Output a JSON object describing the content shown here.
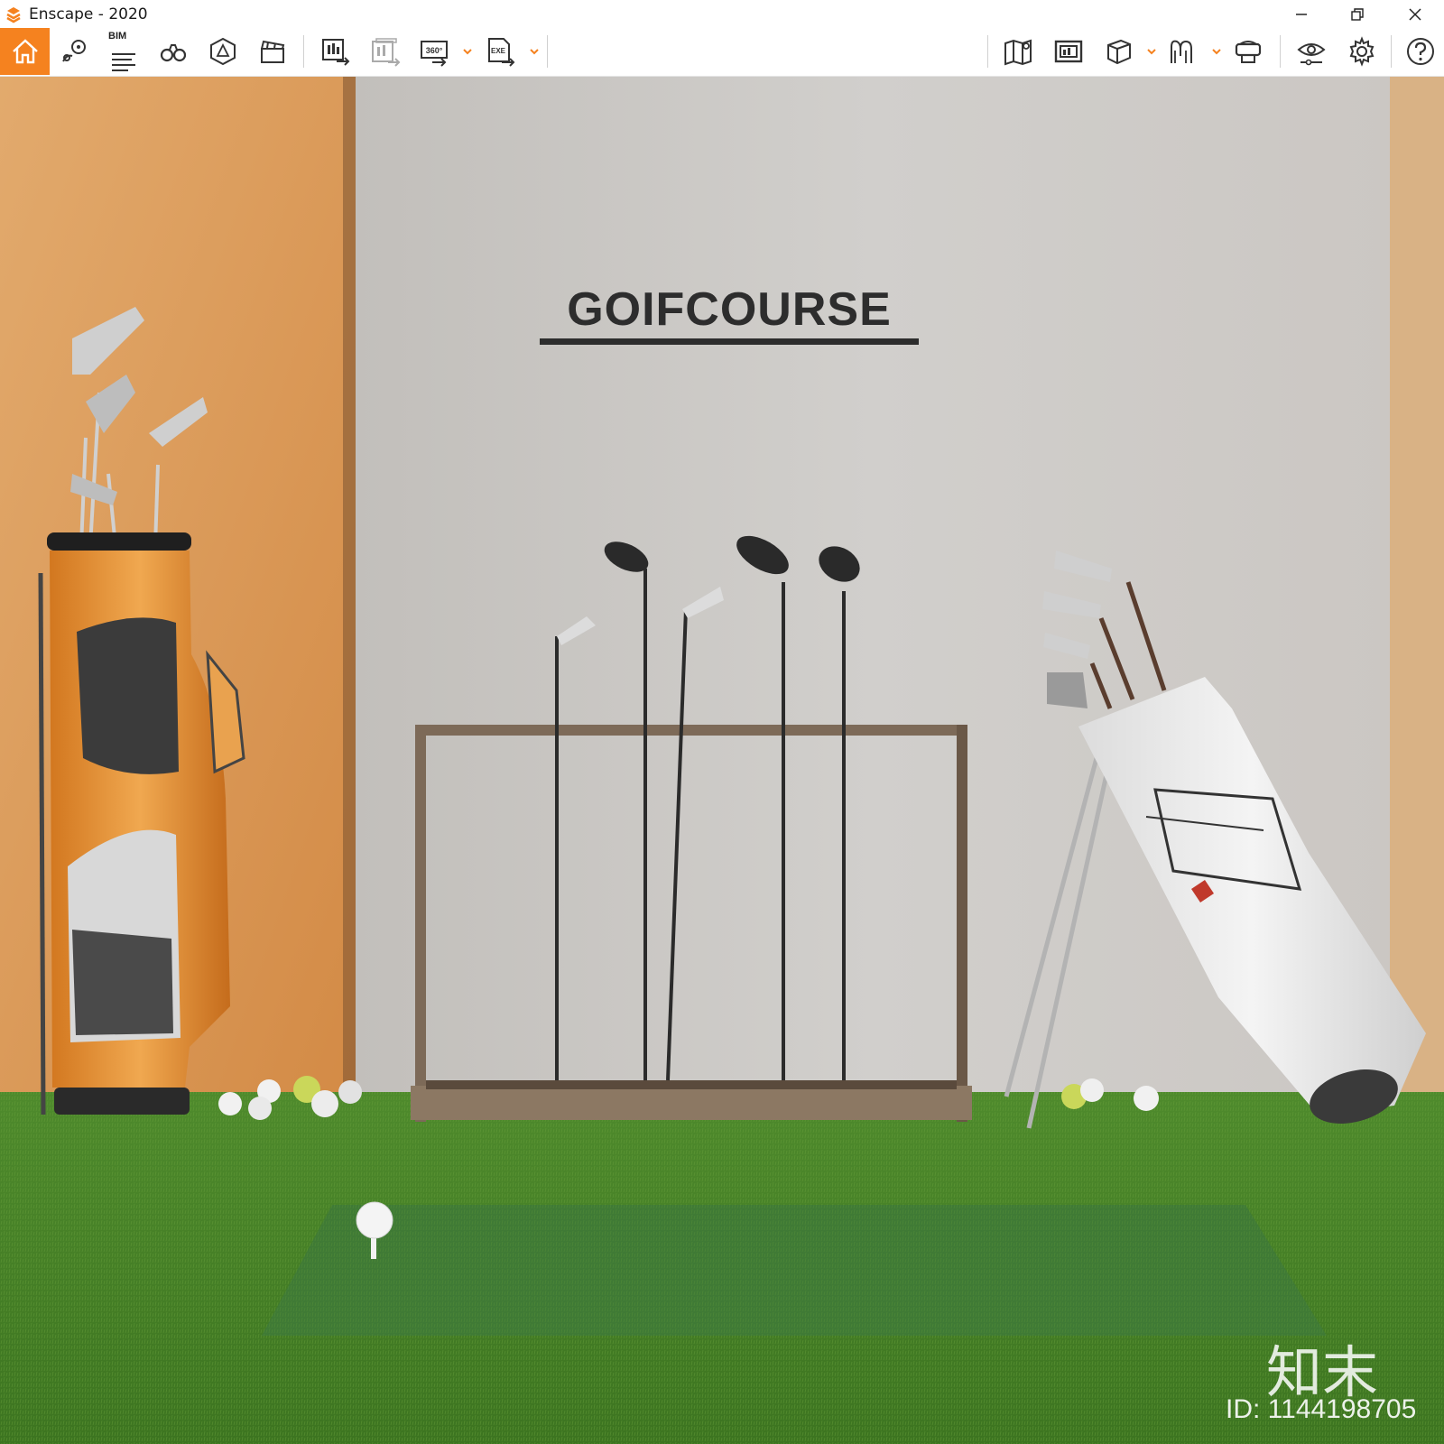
{
  "window": {
    "title": "Enscape - 2020",
    "accent_color": "#f5821f",
    "controls": [
      "minimize-icon",
      "restore-icon",
      "close-icon"
    ]
  },
  "toolbar": {
    "left_buttons": [
      {
        "name": "home",
        "icon": "home-icon"
      },
      {
        "name": "bookmark-views",
        "icon": "map-pin-icon"
      },
      {
        "name": "bim",
        "icon": "bim-list-icon",
        "label": "BIM"
      },
      {
        "name": "walk-mode",
        "icon": "binoculars-icon"
      },
      {
        "name": "asset-library",
        "icon": "asset-cube-icon"
      },
      {
        "name": "video-editor",
        "icon": "clapperboard-icon"
      },
      {
        "name": "render-image",
        "icon": "export-image-icon"
      },
      {
        "name": "batch-render",
        "icon": "batch-render-icon"
      },
      {
        "name": "panorama-360",
        "icon": "panorama-360-icon",
        "label": "360°"
      },
      {
        "name": "export-exe",
        "icon": "export-exe-icon",
        "label": "EXE"
      }
    ],
    "right_buttons": [
      {
        "name": "map",
        "icon": "map-icon"
      },
      {
        "name": "screenshot",
        "icon": "capture-icon"
      },
      {
        "name": "materials",
        "icon": "cube-icon"
      },
      {
        "name": "vr",
        "icon": "vr-icon"
      },
      {
        "name": "headset",
        "icon": "headset-icon"
      },
      {
        "name": "visual-settings",
        "icon": "eye-icon"
      },
      {
        "name": "general-settings",
        "icon": "gear-icon"
      },
      {
        "name": "help",
        "icon": "help-icon"
      }
    ]
  },
  "viewport": {
    "wall_sign": "GOIFCOURSE",
    "watermark_brand": "知末",
    "watermark_id": "ID: 1144198705"
  }
}
